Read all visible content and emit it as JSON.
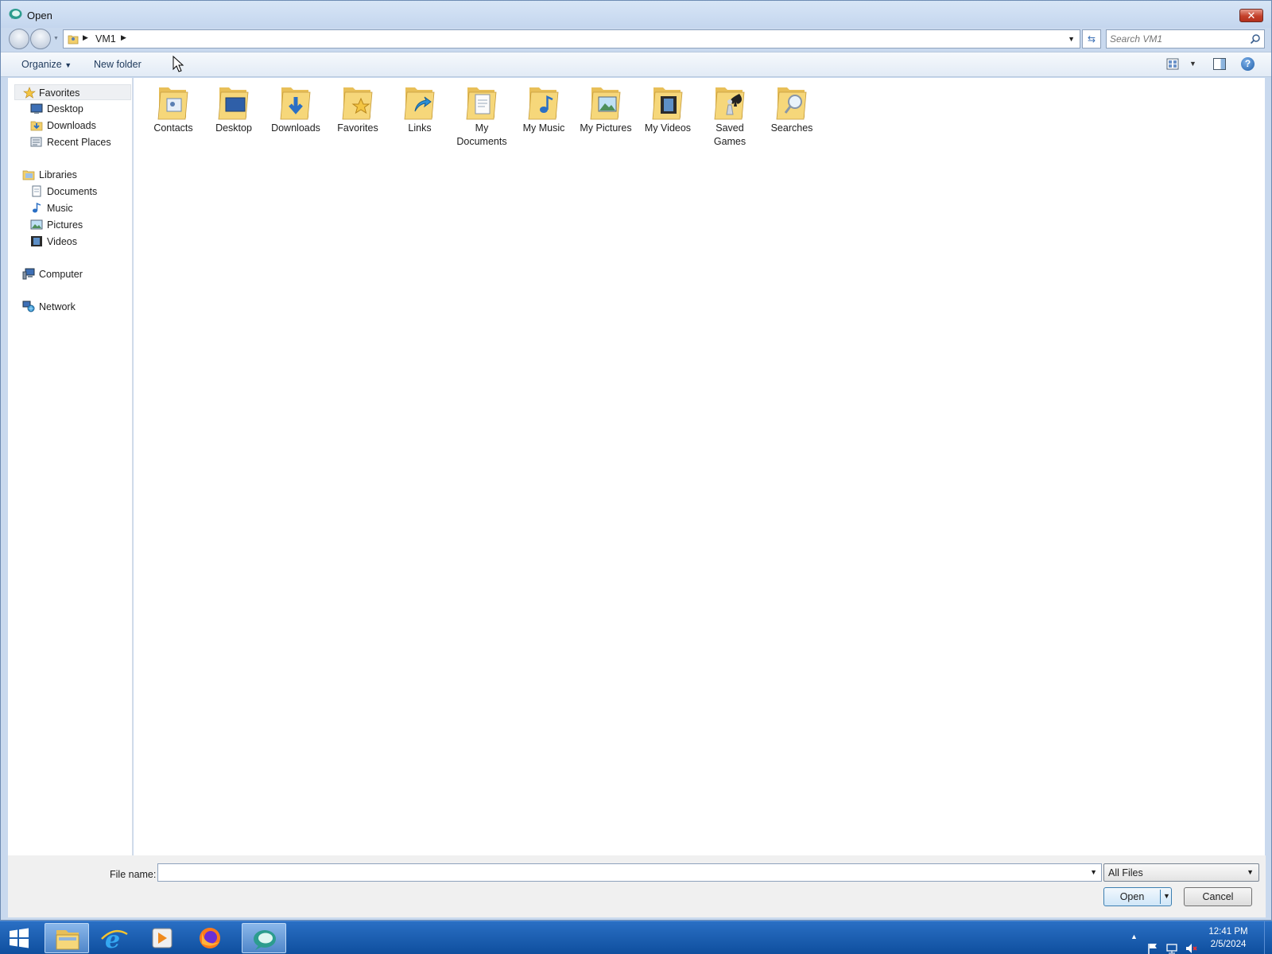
{
  "window": {
    "title": "Open",
    "close_label": "✕"
  },
  "address": {
    "current": "VM1"
  },
  "search": {
    "placeholder": "Search VM1"
  },
  "toolbar": {
    "organize_label": "Organize",
    "new_folder_label": "New folder",
    "help_label": "?"
  },
  "nav": {
    "favorites": {
      "label": "Favorites",
      "items": [
        "Desktop",
        "Downloads",
        "Recent Places"
      ]
    },
    "libraries": {
      "label": "Libraries",
      "items": [
        "Documents",
        "Music",
        "Pictures",
        "Videos"
      ]
    },
    "computer": "Computer",
    "network": "Network"
  },
  "folders": [
    {
      "line1": "Contacts",
      "line2": "",
      "icon": "contacts-folder-icon"
    },
    {
      "line1": "Desktop",
      "line2": "",
      "icon": "desktop-folder-icon"
    },
    {
      "line1": "Downloads",
      "line2": "",
      "icon": "downloads-folder-icon"
    },
    {
      "line1": "Favorites",
      "line2": "",
      "icon": "favorites-folder-icon"
    },
    {
      "line1": "Links",
      "line2": "",
      "icon": "links-folder-icon"
    },
    {
      "line1": "My",
      "line2": "Documents",
      "icon": "documents-folder-icon"
    },
    {
      "line1": "My Music",
      "line2": "",
      "icon": "music-folder-icon"
    },
    {
      "line1": "My Pictures",
      "line2": "",
      "icon": "pictures-folder-icon"
    },
    {
      "line1": "My Videos",
      "line2": "",
      "icon": "videos-folder-icon"
    },
    {
      "line1": "Saved",
      "line2": "Games",
      "icon": "saved-games-folder-icon"
    },
    {
      "line1": "Searches",
      "line2": "",
      "icon": "searches-folder-icon"
    }
  ],
  "bottom": {
    "file_name_label": "File name:",
    "file_name_value": "",
    "filter_value": "All Files",
    "open_label": "Open",
    "cancel_label": "Cancel"
  },
  "taskbar": {
    "time": "12:41 PM",
    "date": "2/5/2024"
  },
  "colors": {
    "accent": "#2a6fc4",
    "folder": "#f2cf6b",
    "selection": "#eef0f3"
  }
}
